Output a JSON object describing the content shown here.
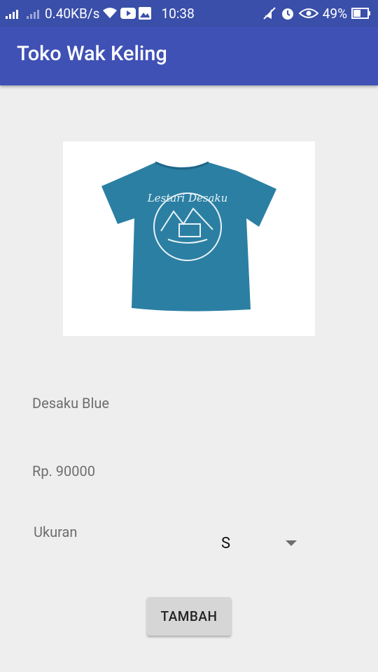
{
  "status_bar": {
    "net_speed": "0.40KB/s",
    "time": "10:38",
    "battery": "49%"
  },
  "app_bar": {
    "title": "Toko Wak Keling"
  },
  "product": {
    "image_label": "Lestari Desaku",
    "name": "Desaku Blue",
    "price": "Rp. 90000",
    "size_label": "Ukuran",
    "size_selected": "S",
    "add_button": "TAMBAH"
  },
  "colors": {
    "status_bar": "#3a4fa9",
    "app_bar": "#3f51b5",
    "shirt": "#2b7fa3",
    "background": "#eeeeee"
  }
}
